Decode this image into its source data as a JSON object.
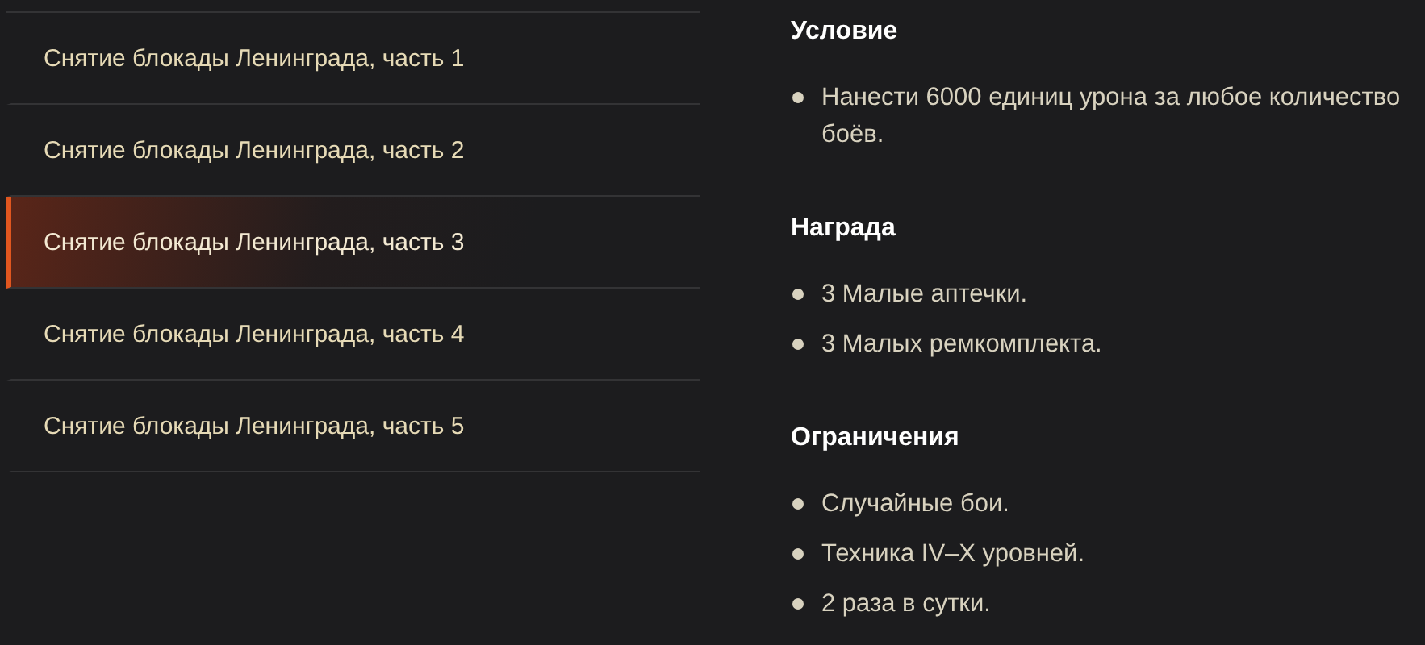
{
  "missions": [
    {
      "label": "Снятие блокады Ленинграда, часть 1",
      "selected": false
    },
    {
      "label": "Снятие блокады Ленинграда, часть 2",
      "selected": false
    },
    {
      "label": "Снятие блокады Ленинграда, часть 3",
      "selected": true
    },
    {
      "label": "Снятие блокады Ленинграда, часть 4",
      "selected": false
    },
    {
      "label": "Снятие блокады Ленинграда, часть 5",
      "selected": false
    }
  ],
  "sections": [
    {
      "heading": "Условие",
      "items": [
        "Нанести 6000 единиц урона за любое количество боёв."
      ]
    },
    {
      "heading": "Награда",
      "items": [
        "3 Малые аптечки.",
        "3 Малых ремкомплекта."
      ]
    },
    {
      "heading": "Ограничения",
      "items": [
        "Случайные бои.",
        "Техника IV–X уровней.",
        "2 раза в сутки."
      ]
    }
  ]
}
